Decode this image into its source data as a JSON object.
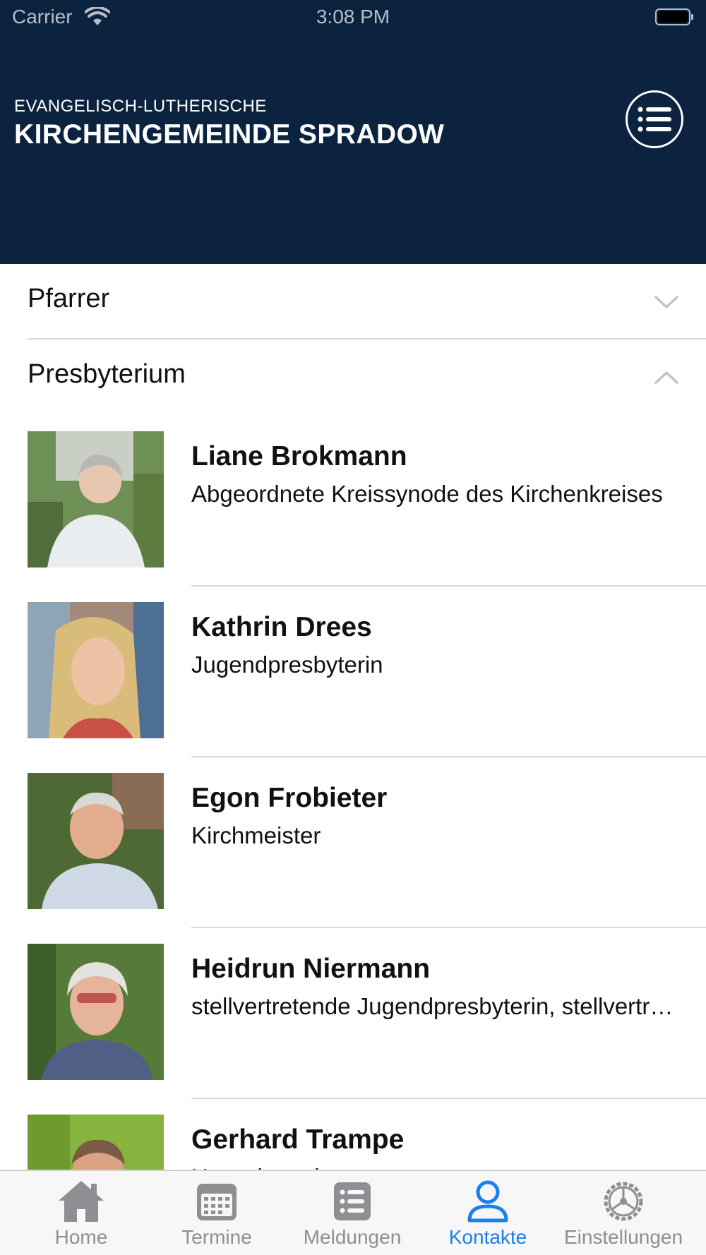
{
  "status_bar": {
    "carrier": "Carrier",
    "time": "3:08 PM"
  },
  "header": {
    "subtitle": "EVANGELISCH-LUTHERISCHE",
    "title": "KIRCHENGEMEINDE SPRADOW",
    "menu_icon": "list-icon"
  },
  "sections": [
    {
      "label": "Pfarrer",
      "expanded": false
    },
    {
      "label": "Presbyterium",
      "expanded": true
    }
  ],
  "contacts": [
    {
      "name": "Liane Brokmann",
      "role": "Abgeordnete Kreissynode des Kirchenkreises"
    },
    {
      "name": "Kathrin Drees",
      "role": "Jugendpresbyterin"
    },
    {
      "name": "Egon Frobieter",
      "role": "Kirchmeister"
    },
    {
      "name": "Heidrun Niermann",
      "role": "stellvertretende Jugendpresbyterin, stellvertretende"
    },
    {
      "name": "Gerhard Trampe",
      "role": "Umweltpresbyter"
    }
  ],
  "tabs": [
    {
      "label": "Home",
      "icon": "home-icon",
      "active": false
    },
    {
      "label": "Termine",
      "icon": "calendar-icon",
      "active": false
    },
    {
      "label": "Meldungen",
      "icon": "news-list-icon",
      "active": false
    },
    {
      "label": "Kontakte",
      "icon": "person-icon",
      "active": true
    },
    {
      "label": "Einstellungen",
      "icon": "settings-icon",
      "active": false
    }
  ],
  "colors": {
    "header_bg": "#0c2340",
    "active_tab": "#1a7ff0",
    "inactive_tab": "#8e8e93"
  }
}
